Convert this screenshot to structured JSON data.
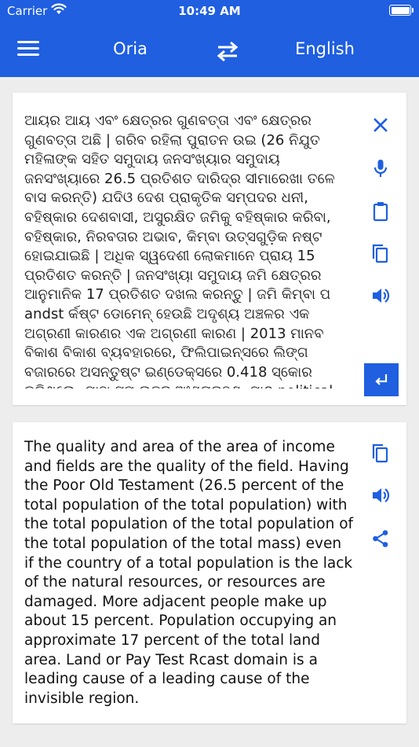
{
  "status_bar": {
    "carrier": "Carrier",
    "time": "10:49 AM"
  },
  "toolbar": {
    "source_language": "Oria",
    "target_language": "English"
  },
  "input": {
    "text": "ଆୟର ଆୟ ଏବଂ କ୍ଷେତ୍ରର ଗୁଣବତ୍ତା ଏବଂ କ୍ଷେତ୍ରର ଗୁଣବତ୍ତା ଅଛି | ଗରିବ ରହିଲା ପୁରାତନ ଉଇ (26 ନିଯୁତ ମହିଳାଙ୍କ ସହିତ ସମୁଦାୟ ଜନସଂଖ୍ୟାର ସମୁଦାୟ ଜନସଂଖ୍ୟାରେ 26.5 ପ୍ରତିଶତ ଦାରିଦ୍ର ସୀମାରେଖା ତଳେ ବାସ କରନ୍ତି) ଯଦିଓ ଦେଶ ପ୍ରାକୃତିକ ସମ୍ପଦର ଧନୀ, ବହିଷ୍କାର ଦେଶବାସୀ, ଅସୁରକ୍ଷିତ ଜମିକୁ ବହିଷ୍କାର କରିବା, ବହିଷ୍କାର, ନିରବତାର ଅଭାବ, କିମ୍ବା ଉତ୍ସଗୁଡ଼ିକ ନଷ୍ଟ ହୋଇଯାଇଛି | ଅଧିକ ସ୍ୱଦେଶୀ ଲୋକମାନେ ପ୍ରାୟ 15 ପ୍ରତିଶତ କରନ୍ତି | ଜନସଂଖ୍ୟା ସମୁଦାୟ ଜମି କ୍ଷେତ୍ରର ଆନୁମାନିକ 17 ପ୍ରତିଶତ ଦଖଲ କରନ୍ତୁ | ଜମି କିମ୍ବା ପ andst ର୍କଷ୍ଟ ଡୋମେନ୍ ହେଉଛି ଅଦୃଶ୍ୟ ଅଞ୍ଚଳର ଏକ ଅଗ୍ରଣୀ କାରଣର ଏକ ଅଗ୍ରଣୀ କାରଣ | 2013 ମାନବ ବିକାଶ ବିକାଶ ବ୍ୟବହାରରେ, ଫିଲିପାଇନ୍ସରେ ଲିଙ୍ଗ ବଜାରରେ ଅସନ୍ତୁଷ୍ଟ ଇଣ୍ଡେକ୍ସରେ 0.418 ସ୍କୋର କରିଥିଲେ, ଯାହା ସମ ଉଚ୍ଚତ ଅଂଶଗ୍ରହଣ, ପାଠ political ଦିଗ"
  },
  "output": {
    "text": "The quality and area of the area of income and fields are the quality of the field. Having the Poor Old Testament (26.5 percent of the total population of the total population) with the total population of the total population of the total population of the total mass) even if the country of a total population is the lack of the natural resources, or resources are damaged. More adjacent people make up about 15 percent. Population occupying an approximate 17 percent of the total land area. Land or Pay Test Rcast domain is a leading cause of a leading cause of the invisible region."
  },
  "icons": {
    "input_actions": [
      "close-icon",
      "microphone-icon",
      "clipboard-icon",
      "copy-icon",
      "speaker-icon",
      "enter-icon"
    ],
    "output_actions": [
      "copy-icon",
      "speaker-icon",
      "share-icon"
    ]
  },
  "colors": {
    "header": "#1f5fe0",
    "accent": "#1f5fe0",
    "background": "#ededed"
  }
}
